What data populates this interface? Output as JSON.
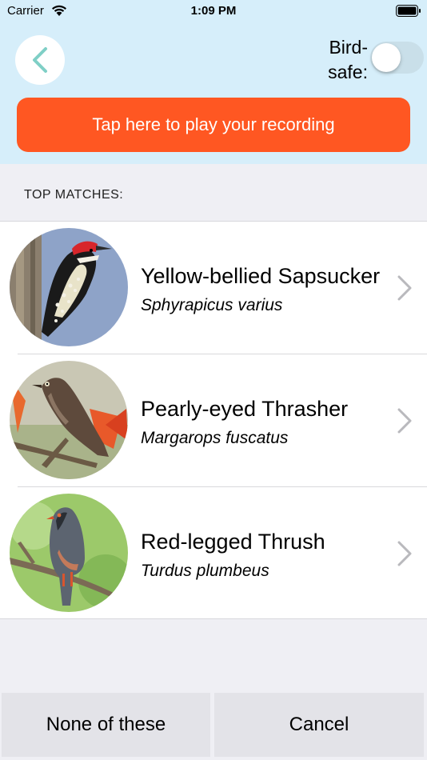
{
  "status_bar": {
    "carrier": "Carrier",
    "time": "1:09 PM"
  },
  "header": {
    "birdsafe_label": "Bird-safe:",
    "birdsafe_on": false,
    "play_label": "Tap here to play your recording",
    "accent_color": "#ff5722",
    "background_color": "#d6eefa"
  },
  "section": {
    "title": "TOP MATCHES:"
  },
  "matches": [
    {
      "common_name": "Yellow-bellied Sapsucker",
      "scientific_name": "Sphyrapicus varius"
    },
    {
      "common_name": "Pearly-eyed Thrasher",
      "scientific_name": "Margarops fuscatus"
    },
    {
      "common_name": "Red-legged Thrush",
      "scientific_name": "Turdus plumbeus"
    }
  ],
  "footer": {
    "none_label": "None of these",
    "cancel_label": "Cancel"
  }
}
